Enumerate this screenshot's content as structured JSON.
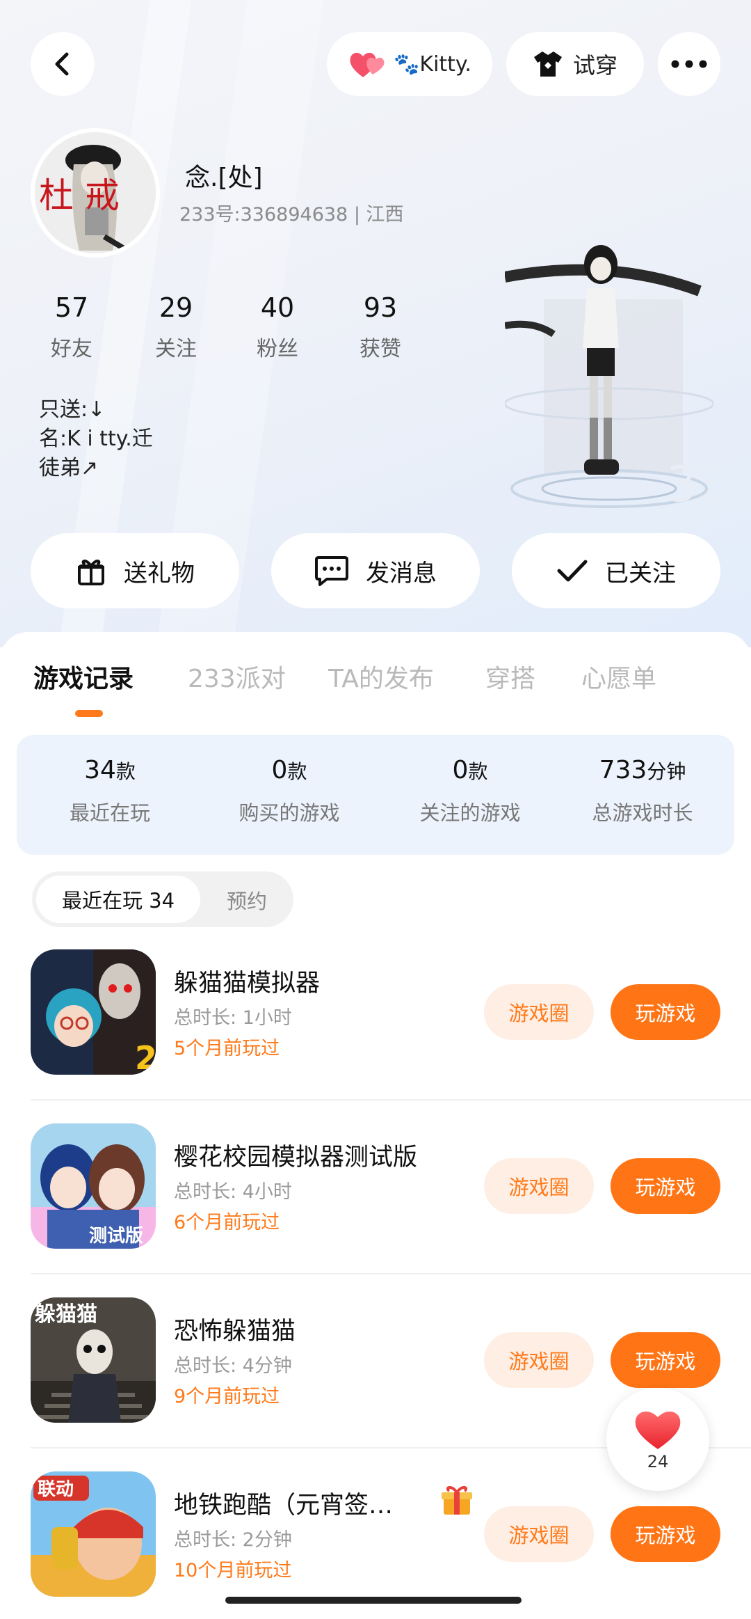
{
  "header": {
    "kitty_label": "🐾Kitty.",
    "tryon_label": "试穿"
  },
  "profile": {
    "nickname": "念.[处]",
    "uid_line": "233号:336894638 | 江西",
    "avatar_text": "杜 戒",
    "bio": "只送:↓\n名:K i tty.迁\n徒弟↗"
  },
  "stats": [
    {
      "value": "57",
      "label": "好友"
    },
    {
      "value": "29",
      "label": "关注"
    },
    {
      "value": "40",
      "label": "粉丝"
    },
    {
      "value": "93",
      "label": "获赞"
    }
  ],
  "actions": {
    "gift": "送礼物",
    "message": "发消息",
    "follow": "已关注"
  },
  "tabs": [
    "游戏记录",
    "233派对",
    "TA的发布",
    "穿搭",
    "心愿单"
  ],
  "summary": [
    {
      "value": "34",
      "unit": "款",
      "label": "最近在玩"
    },
    {
      "value": "0",
      "unit": "款",
      "label": "购买的游戏"
    },
    {
      "value": "0",
      "unit": "款",
      "label": "关注的游戏"
    },
    {
      "value": "733",
      "unit": "分钟",
      "label": "总游戏时长"
    }
  ],
  "segment": {
    "active": "最近在玩 34",
    "inactive": "预约"
  },
  "games": [
    {
      "name": "躲猫猫模拟器",
      "duration": "总时长: 1小时",
      "last": "5个月前玩过",
      "badge": "2"
    },
    {
      "name": "樱花校园模拟器测试版",
      "duration": "总时长: 4小时",
      "last": "6个月前玩过",
      "badge": "测试版"
    },
    {
      "name": "恐怖躲猫猫",
      "duration": "总时长: 4分钟",
      "last": "9个月前玩过",
      "badge": "躲猫猫"
    },
    {
      "name": "地铁跑酷（元宵签…",
      "duration": "总时长: 2分钟",
      "last": "10个月前玩过",
      "badge": "联动"
    }
  ],
  "game_buttons": {
    "circle": "游戏圈",
    "play": "玩游戏"
  },
  "like_float": {
    "count": "24"
  },
  "colors": {
    "accent": "#ff7415",
    "accent_light": "#ffeee3",
    "summary_bg": "#edf3fc"
  }
}
